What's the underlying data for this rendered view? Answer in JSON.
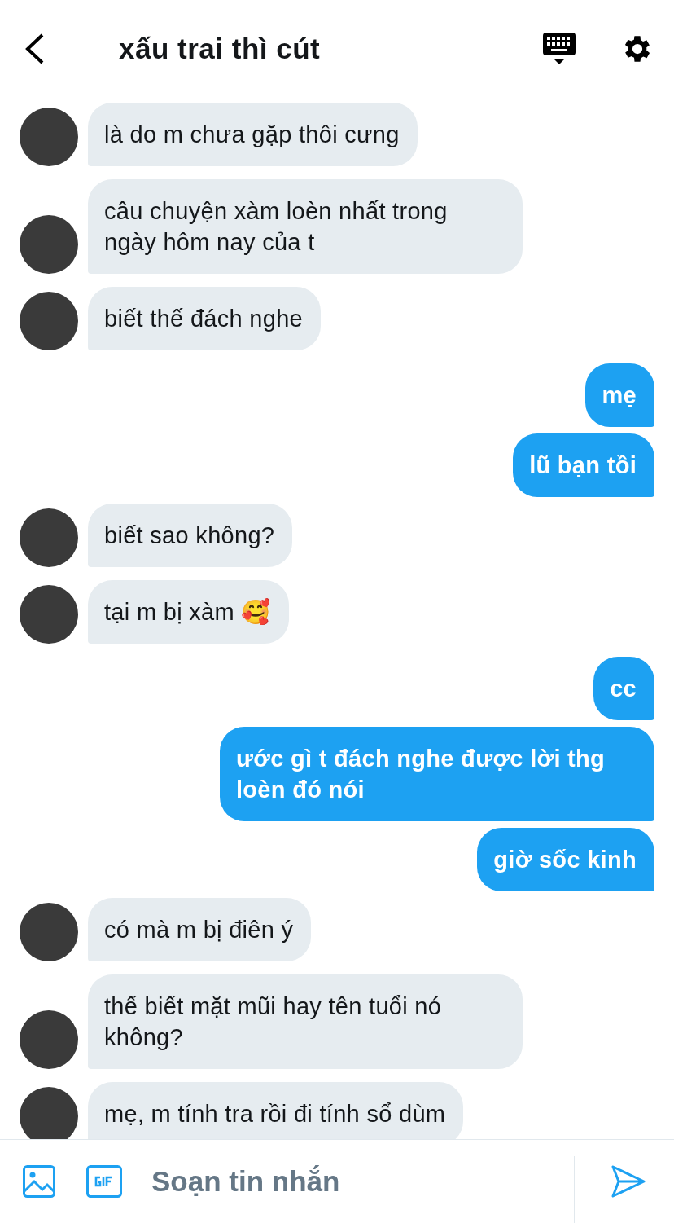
{
  "header": {
    "title": "xấu trai thì cút"
  },
  "messages": [
    {
      "kind": "them",
      "text": "là do m chưa gặp thôi cưng"
    },
    {
      "kind": "them",
      "text": "câu chuyện xàm loèn nhất trong ngày hôm nay của t"
    },
    {
      "kind": "them",
      "text": "biết thế đách nghe"
    },
    {
      "kind": "me",
      "text": "mẹ"
    },
    {
      "kind": "me",
      "text": "lũ bạn tồi"
    },
    {
      "kind": "them",
      "text": "biết sao không?"
    },
    {
      "kind": "them",
      "text": "tại m bị xàm 🥰"
    },
    {
      "kind": "me",
      "text": "cc"
    },
    {
      "kind": "me",
      "text": "ước gì t đách nghe được lời thg loèn đó nói"
    },
    {
      "kind": "me",
      "text": "giờ sốc kinh"
    },
    {
      "kind": "them",
      "text": "có mà m bị điên ý"
    },
    {
      "kind": "them",
      "text": "thế biết mặt mũi hay tên tuổi nó không?"
    },
    {
      "kind": "them",
      "text": "mẹ, m tính tra rồi đi tính sổ dùm"
    }
  ],
  "composer": {
    "placeholder": "Soạn tin nhắn"
  }
}
